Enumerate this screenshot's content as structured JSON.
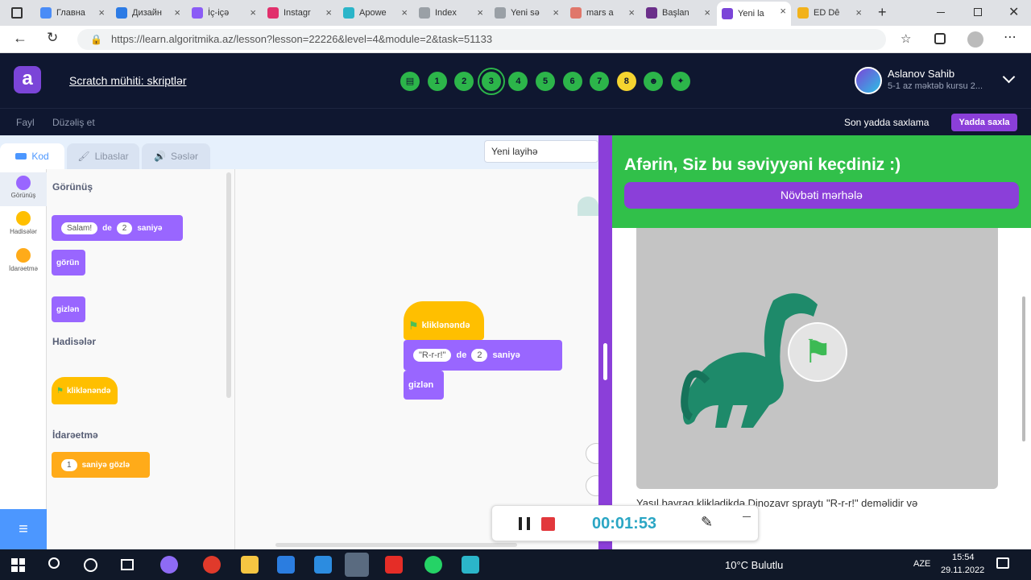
{
  "browser": {
    "tabs": [
      {
        "label": "Главна",
        "color": "#4a8cf7"
      },
      {
        "label": "Дизайн",
        "color": "#2d7be5"
      },
      {
        "label": "İç-içə",
        "color": "#8b5cf6"
      },
      {
        "label": "Instagr",
        "color": "#e1306c"
      },
      {
        "label": "Apowe",
        "color": "#2bb5c9"
      },
      {
        "label": "Index",
        "color": "#9aa0a6"
      },
      {
        "label": "Yeni sə",
        "color": "#9aa0a6"
      },
      {
        "label": "mars a",
        "color": "#e0776b"
      },
      {
        "label": "Başlan",
        "color": "#6b2f8a"
      },
      {
        "label": "Yeni la",
        "color": "#7b45d8"
      },
      {
        "label": "ED Dê",
        "color": "#f2b21b"
      }
    ],
    "url": "https://learn.algoritmika.az/lesson?lesson=22226&level=4&module=2&task=51133"
  },
  "header": {
    "logo": "a",
    "title": "Scratch mühiti: skriptlər",
    "steps": [
      "doc",
      "1",
      "2",
      "3",
      "4",
      "5",
      "6",
      "7",
      "8",
      "smile",
      "grid"
    ],
    "user_name": "Aslanov Sahib",
    "user_subtitle": "5-1 az məktəb kursu 2..."
  },
  "menu": {
    "file": "Fayl",
    "edit": "Düzəliş et",
    "last_saved": "Son yadda saxlama",
    "save_button": "Yadda saxla"
  },
  "scratch": {
    "tabs": {
      "code": "Kod",
      "costumes": "Libaslar",
      "sounds": "Səslər"
    },
    "project_name": "Yeni layihə",
    "categories": [
      {
        "label": "Görünüş",
        "color": "#9966ff"
      },
      {
        "label": "Hadisələr",
        "color": "#ffbf00"
      },
      {
        "label": "İdarəetmə",
        "color": "#ffab19"
      }
    ],
    "palette": {
      "looks_heading": "Görünüş",
      "say_text": "Salam!",
      "say_mid": "de",
      "say_num": "2",
      "say_end": "saniyə",
      "show": "görün",
      "hide": "gizlən",
      "events_heading": "Hadisələr",
      "flag_clicked": "kliklənəndə",
      "control_heading": "İdarəetmə",
      "wait_num": "1",
      "wait_text": "saniyə gözlə"
    },
    "script": {
      "flag_clicked": "kliklənəndə",
      "say_text": "\"R-r-r!\"",
      "say_mid": "de",
      "say_num": "2",
      "say_end": "saniyə",
      "hide": "gizlən"
    }
  },
  "panel": {
    "success_title": "Afərin, Siz bu səviyyəni keçdiniz :)",
    "next_button": "Növbəti mərhələ",
    "task_text": "Yaşıl bayraq kliklədikdə Dinozavr spraytı \"R-r-r!\" deməlidir və"
  },
  "recorder": {
    "time": "00:01:53"
  },
  "taskbar": {
    "weather": "10°C Bulutlu",
    "lang": "AZE",
    "time": "15:54",
    "date": "29.11.2022"
  },
  "colors": {
    "header_bg": "#0f1730",
    "accent_purple": "#8b3fd9",
    "success_green": "#31c04a",
    "step_green": "#2cb54a",
    "step_yellow": "#f5d430",
    "looks": "#9966ff",
    "events": "#ffbf00",
    "control": "#ffab19"
  }
}
